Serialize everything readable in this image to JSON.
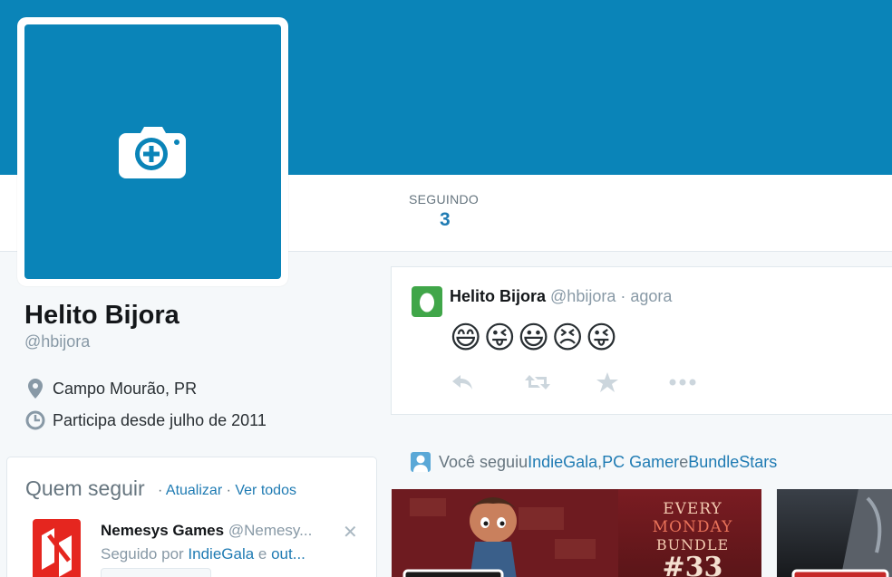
{
  "profile": {
    "name": "Helito Bijora",
    "handle": "@hbijora",
    "location": "Campo Mourão, PR",
    "joined": "Participa desde julho de 2011"
  },
  "stats": {
    "following_label": "SEGUINDO",
    "following_count": "3"
  },
  "who_to_follow": {
    "title": "Quem seguir",
    "sep1": " · ",
    "refresh_label": "Atualizar",
    "sep2": " · ",
    "view_all_label": "Ver todos",
    "suggestion": {
      "name": "Nemesys Games",
      "handle": "@Nemesy...",
      "followed_by_prefix": "Seguido por ",
      "followed_by_link": "IndieGala",
      "followed_by_and": " e ",
      "followed_by_others": "out..."
    }
  },
  "tweet": {
    "name": "Helito Bijora",
    "handle": "@hbijora",
    "time": "agora",
    "sep": " · ",
    "text": "😄😜😃😣😜"
  },
  "notice": {
    "prefix": "Você seguiu ",
    "link1": "IndieGala",
    "comma": ", ",
    "link2": "PC Gamer",
    "and": " e ",
    "link3": "BundleStars"
  },
  "promo": {
    "line1": "EVERY",
    "line2": "MONDAY",
    "line3": "BUNDLE",
    "line4": "#33"
  },
  "colors": {
    "brand_blue": "#0a84b8",
    "link_blue": "#1f7bb3",
    "egg_green": "#40a649"
  },
  "icons": {
    "avatar_upload": "camera-plus-icon",
    "location": "map-pin-icon",
    "joined": "clock-icon",
    "close": "close-icon",
    "reply": "reply-icon",
    "retweet": "retweet-icon",
    "favorite": "star-icon",
    "more": "more-icon",
    "notice": "person-icon"
  }
}
